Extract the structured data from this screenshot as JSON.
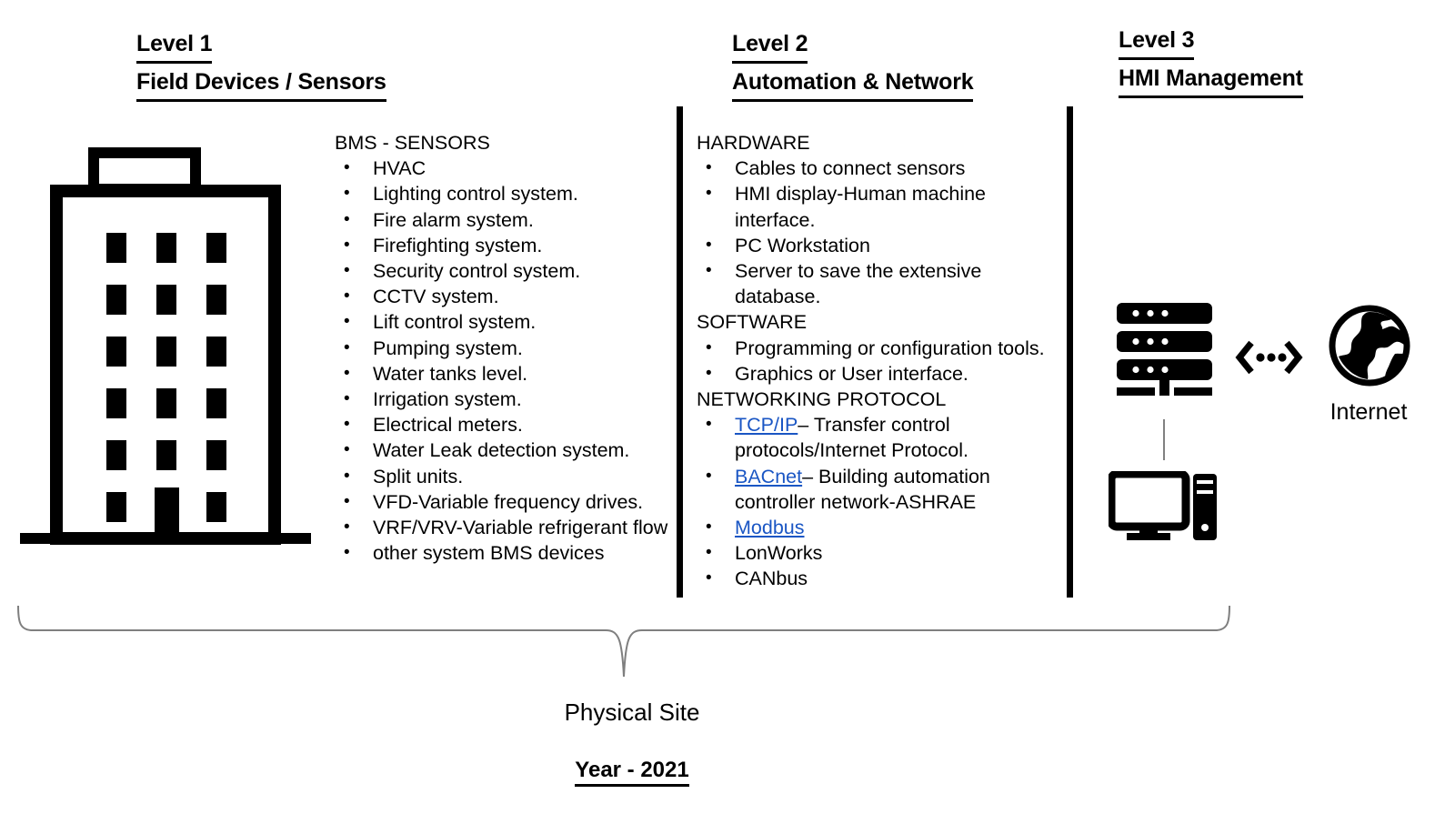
{
  "diagram": {
    "columns": [
      {
        "id": "level-1",
        "level_label": "Level 1",
        "title": "Field Devices / Sensors",
        "icon": "building-icon",
        "sections": [
          {
            "heading": "BMS - SENSORS",
            "items": [
              "HVAC",
              "Lighting control system.",
              "Fire alarm system.",
              "Firefighting system.",
              "Security control system.",
              "CCTV system.",
              "Lift control system.",
              "Pumping system.",
              "Water tanks level.",
              "Irrigation system.",
              "Electrical meters.",
              "Water Leak detection system.",
              "Split units.",
              "VFD-Variable frequency drives.",
              "VRF/VRV-Variable refrigerant flow",
              "other system BMS devices"
            ]
          }
        ]
      },
      {
        "id": "level-2",
        "level_label": "Level 2",
        "title": "Automation & Network",
        "sections": [
          {
            "heading": "HARDWARE",
            "items": [
              "Cables to connect sensors",
              "HMI display-Human machine interface.",
              "PC Workstation",
              "Server to save the extensive database."
            ]
          },
          {
            "heading": "SOFTWARE",
            "items": [
              "Programming or configuration tools.",
              "Graphics or User interface."
            ]
          },
          {
            "heading": "NETWORKING PROTOCOL",
            "protocol_items": [
              {
                "link": "TCP/IP",
                "rest": "– Transfer control protocols/Internet Protocol."
              },
              {
                "link": "BACnet",
                "rest": "– Building automation controller network-ASHRAE"
              },
              {
                "link": "Modbus",
                "rest": ""
              },
              {
                "link": "",
                "rest": "LonWorks"
              },
              {
                "link": "",
                "rest": "CANbus"
              }
            ]
          }
        ]
      },
      {
        "id": "level-3",
        "level_label": "Level 3",
        "title": "HMI Management ",
        "icons": {
          "server": "server-rack-icon",
          "connector": "bidirectional-link-icon",
          "globe": "globe-icon",
          "workstation": "desktop-pc-icon"
        },
        "internet_label": "Internet"
      }
    ],
    "footer": {
      "brace_caption": "Physical Site",
      "year": "Year - 2021"
    },
    "colors": {
      "stroke": "#000000",
      "link": "#1a56c4",
      "connector_line": "#808080",
      "brace": "#7f7f7f",
      "background": "#ffffff"
    }
  }
}
